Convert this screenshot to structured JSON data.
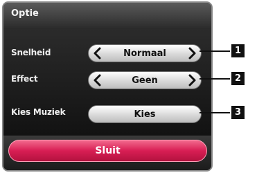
{
  "dialog": {
    "title": "Optie",
    "rows": [
      {
        "label": "Snelheid",
        "value": "Normaal",
        "left_icon": "chevron-left-icon",
        "right_icon": "chevron-right-icon"
      },
      {
        "label": "Effect",
        "value": "Geen",
        "left_icon": "chevron-left-icon",
        "right_icon": "chevron-right-icon"
      },
      {
        "label": "Kies Muziek",
        "button_label": "Kies"
      }
    ],
    "close_button": "Sluit"
  },
  "callouts": [
    "1",
    "2",
    "3"
  ],
  "colors": {
    "title_bar": "#3c3c3c",
    "panel": "#1a1a1a",
    "pill": "#e6e6e6",
    "close_button": "#d81e54"
  }
}
